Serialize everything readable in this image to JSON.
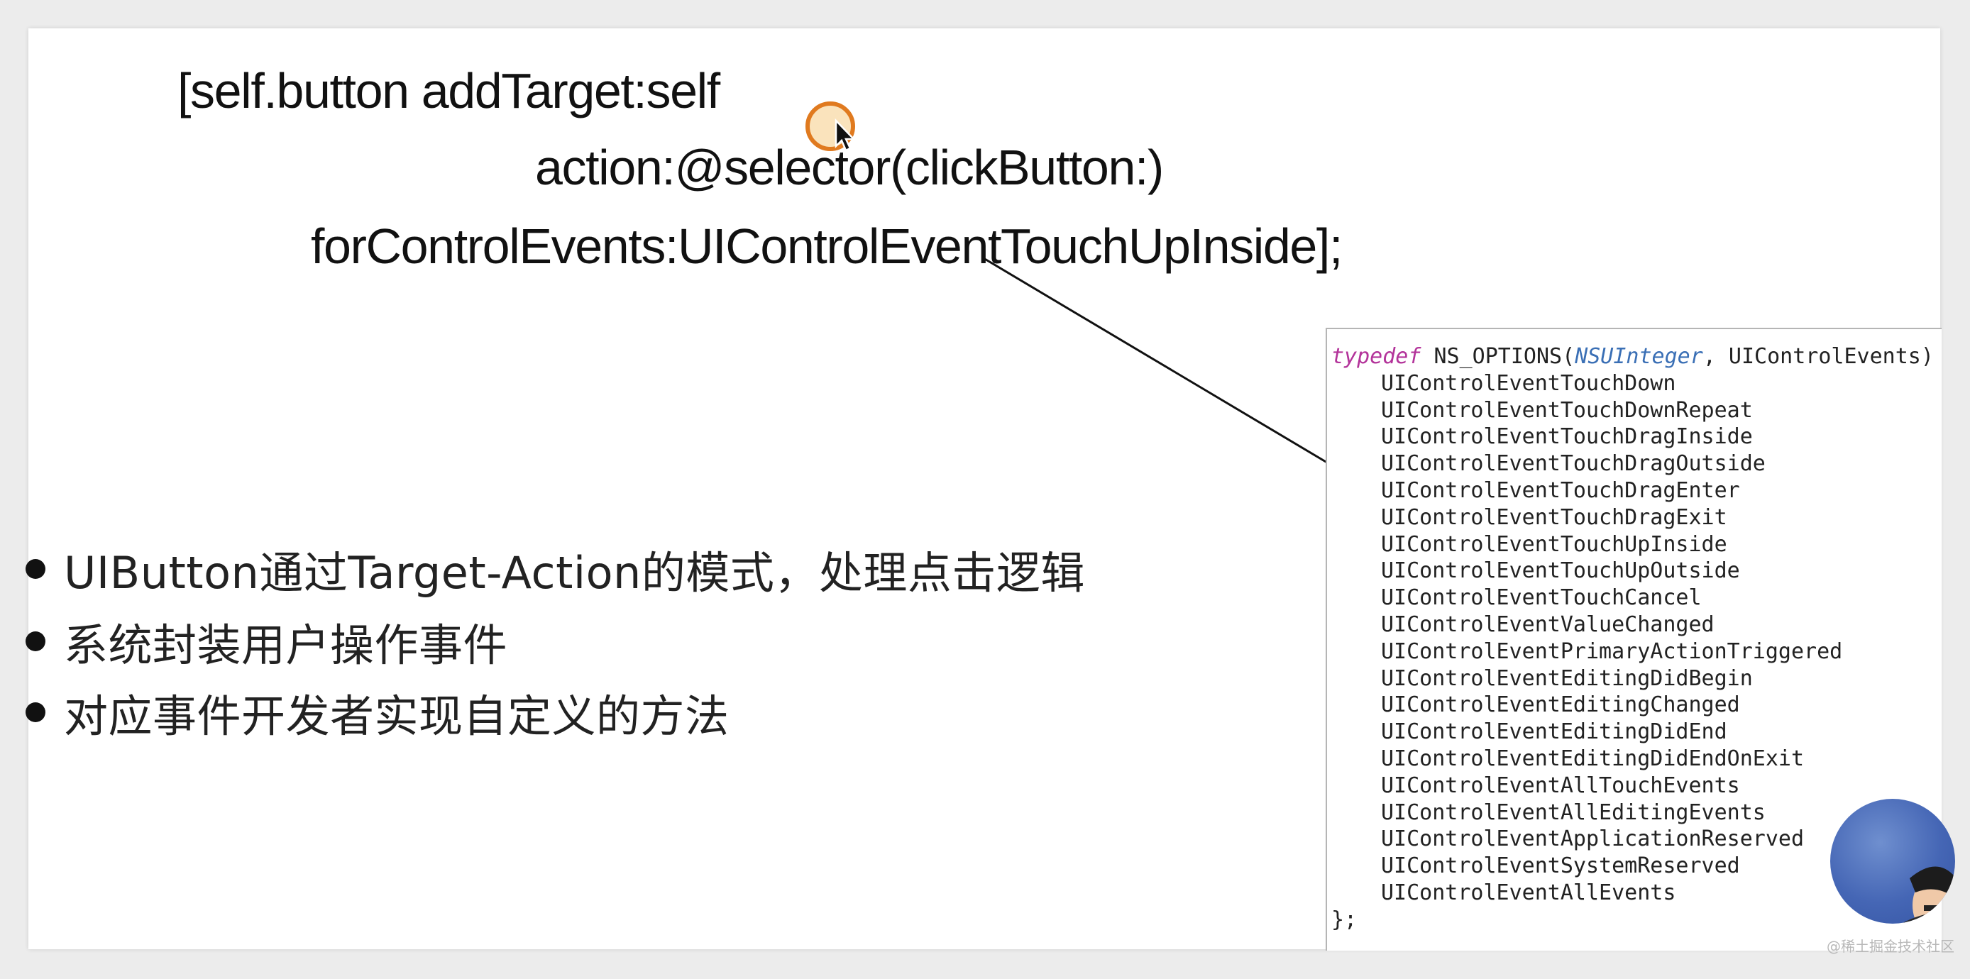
{
  "slide": {
    "code_lines": [
      "[self.button addTarget:self",
      "action:@selector(clickButton:)",
      "forControlEvents:UIControlEventTouchUpInside];"
    ],
    "bullets": [
      "UIButton通过Target-Action的模式，处理点击逻辑",
      "系统封装用户操作事件",
      "对应事件开发者实现自定义的方法"
    ]
  },
  "code_panel": {
    "keyword": "typedef",
    "macro": "NS_OPTIONS(",
    "type_name": "NSUInteger",
    "decl_tail": ", UIControlEvents) {",
    "items": [
      "UIControlEventTouchDown",
      "UIControlEventTouchDownRepeat",
      "UIControlEventTouchDragInside",
      "UIControlEventTouchDragOutside",
      "UIControlEventTouchDragEnter",
      "UIControlEventTouchDragExit",
      "UIControlEventTouchUpInside",
      "UIControlEventTouchUpOutside",
      "UIControlEventTouchCancel",
      "UIControlEventValueChanged",
      "UIControlEventPrimaryActionTriggered",
      "UIControlEventEditingDidBegin",
      "UIControlEventEditingChanged",
      "UIControlEventEditingDidEnd",
      "UIControlEventEditingDidEndOnExit",
      "UIControlEventAllTouchEvents",
      "UIControlEventAllEditingEvents",
      "UIControlEventApplicationReserved",
      "UIControlEventSystemReserved",
      "UIControlEventAllEvents"
    ],
    "closing": "};"
  },
  "watermark": "@稀土掘金技术社区",
  "colors": {
    "background": "#ececec",
    "slide": "#ffffff",
    "text": "#111111",
    "keyword": "#b3339a",
    "type": "#3a6fb5",
    "cursor_ring": "#e07a1f",
    "webcam": "#4566b5"
  },
  "icons": [
    "mouse-pointer-icon",
    "click-highlight-ring-icon"
  ]
}
